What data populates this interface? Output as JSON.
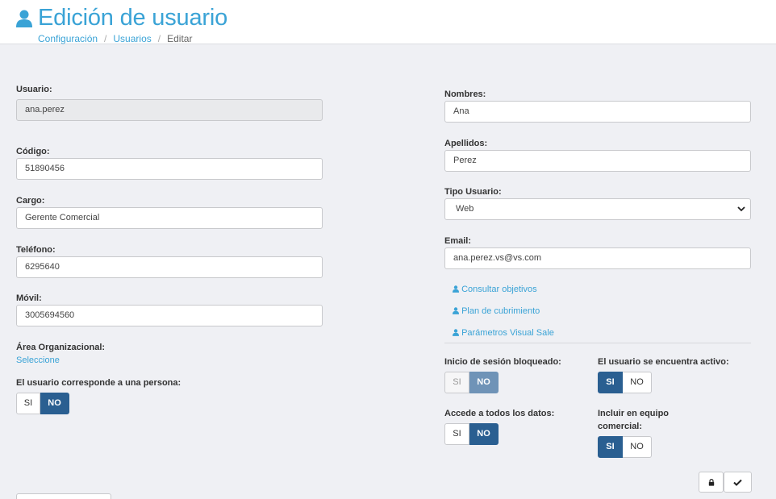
{
  "header": {
    "title": "Edición de usuario",
    "icon": "user-icon",
    "breadcrumb": [
      "Configuración",
      "Usuarios",
      "Editar"
    ],
    "breadcrumb_sep": "/"
  },
  "left": {
    "usuario": {
      "label": "Usuario:",
      "value": "ana.perez"
    },
    "codigo": {
      "label": "Código:",
      "value": "51890456"
    },
    "cargo": {
      "label": "Cargo:",
      "value": "Gerente Comercial"
    },
    "telefono": {
      "label": "Teléfono:",
      "value": "6295640"
    },
    "movil": {
      "label": "Móvil:",
      "value": "3005694560"
    },
    "area": {
      "label": "Área Organizacional:",
      "link": "Seleccione"
    },
    "persona": {
      "label": "El usuario corresponde a una persona:",
      "si": "SI",
      "no": "NO",
      "selected": "NO"
    }
  },
  "right": {
    "nombres": {
      "label": "Nombres:",
      "value": "Ana"
    },
    "apellidos": {
      "label": "Apellidos:",
      "value": "Perez"
    },
    "tipo": {
      "label": "Tipo Usuario:",
      "value": "Web"
    },
    "email": {
      "label": "Email:",
      "value": "ana.perez.vs@vs.com"
    },
    "links": [
      "Consultar objetivos",
      "Plan de cubrimiento",
      "Parámetros Visual Sale"
    ],
    "bloqueado": {
      "label": "Inicio de sesión bloqueado:",
      "si": "SI",
      "no": "NO",
      "selected": "NO"
    },
    "activo": {
      "label": "El usuario se encuentra activo:",
      "si": "SI",
      "no": "NO",
      "selected": "SI"
    },
    "todos_datos": {
      "label": "Accede a todos los datos:",
      "si": "SI",
      "no": "NO",
      "selected": "NO"
    },
    "equipo": {
      "label_line1": "Incluir en equipo",
      "label_line2": "comercial:",
      "si": "SI",
      "no": "NO",
      "selected": "SI"
    }
  },
  "actions": {
    "lock_icon": "lock-icon",
    "save_icon": "check-icon"
  },
  "colors": {
    "accent": "#3aa3d6",
    "toggle_active": "#2a5f91",
    "toggle_muted": "#6f93b7",
    "background": "#eff0f4"
  }
}
